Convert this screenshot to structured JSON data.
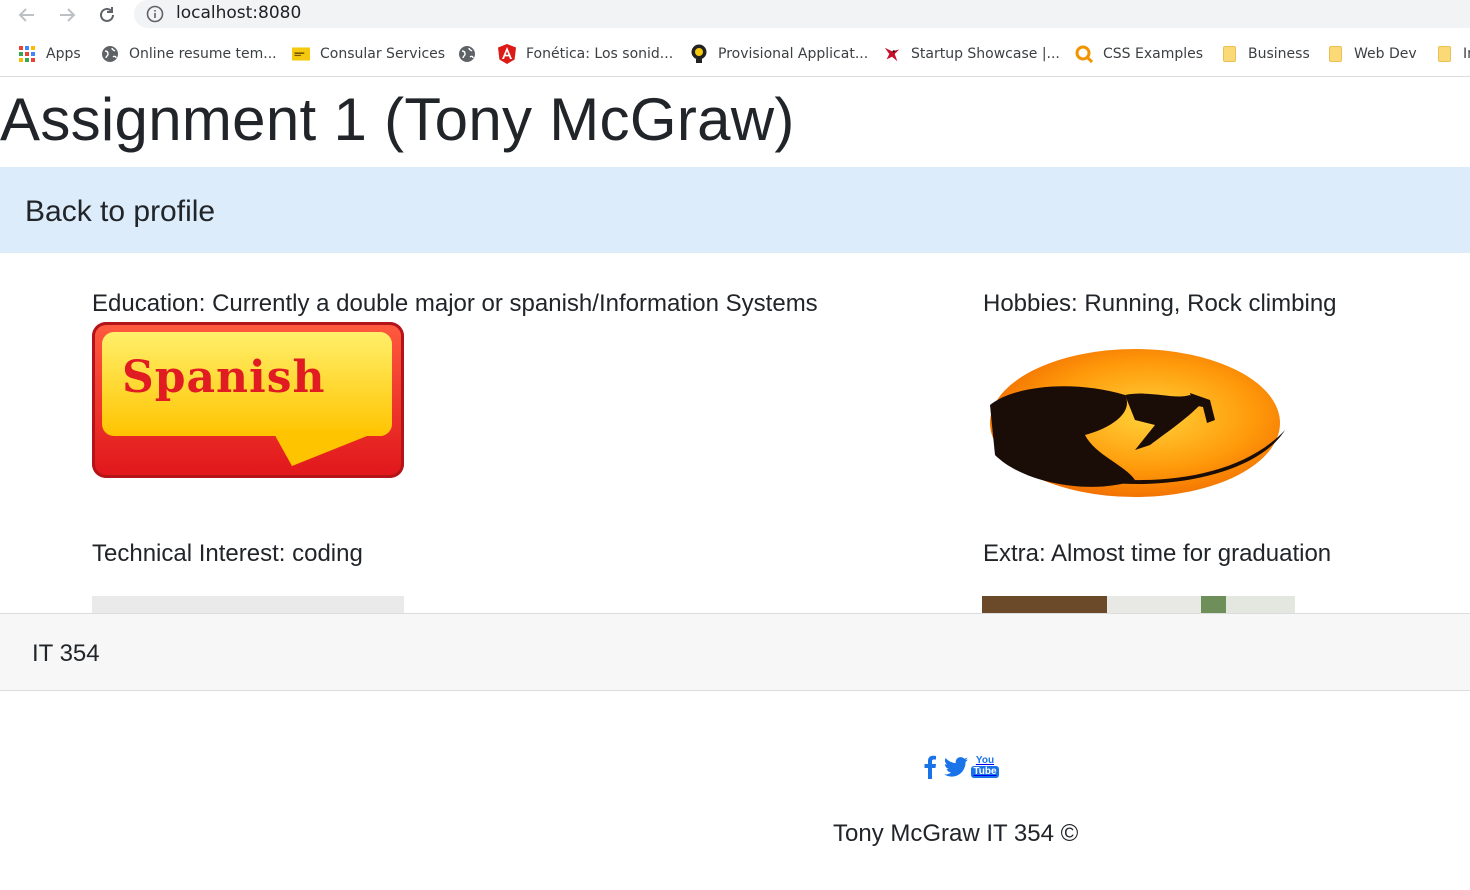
{
  "browser": {
    "url": "localhost:8080",
    "bookmarks": [
      {
        "label": "Apps",
        "icon": "apps-grid-icon"
      },
      {
        "label": "Online resume tem...",
        "icon": "globe-icon"
      },
      {
        "label": "Consular Services",
        "icon": "consular-icon"
      },
      {
        "label": "",
        "icon": "globe-icon"
      },
      {
        "label": "Fonética: Los sonid...",
        "icon": "angular-icon"
      },
      {
        "label": "Provisional Applicat...",
        "icon": "lightbulb-icon"
      },
      {
        "label": "Startup Showcase |...",
        "icon": "cardinal-icon"
      },
      {
        "label": "CSS Examples",
        "icon": "search-orange-icon"
      },
      {
        "label": "Business",
        "icon": "folder-icon"
      },
      {
        "label": "Web Dev",
        "icon": "folder-icon"
      },
      {
        "label": "In",
        "icon": "folder-icon"
      }
    ]
  },
  "page": {
    "title": "Assignment 1 (Tony McGraw)",
    "profile_link": "Back to profile",
    "cards": [
      {
        "title": "Education: Currently a double major or spanish/Information Systems",
        "image_text": "Spanish"
      },
      {
        "title": "Hobbies: Running, Rock climbing"
      },
      {
        "title": "Technical Interest: coding"
      },
      {
        "title": "Extra: Almost time for graduation"
      }
    ],
    "footer_label": "IT 354",
    "social": [
      "facebook-icon",
      "twitter-icon",
      "youtube-icon"
    ],
    "youtube_text": [
      "You",
      "Tube"
    ],
    "copyright": "Tony McGraw IT 354 ©"
  },
  "colors": {
    "profile_bar": "#dcecfa",
    "footer_bar": "#f7f7f7",
    "social_blue": "#1a73e8"
  }
}
